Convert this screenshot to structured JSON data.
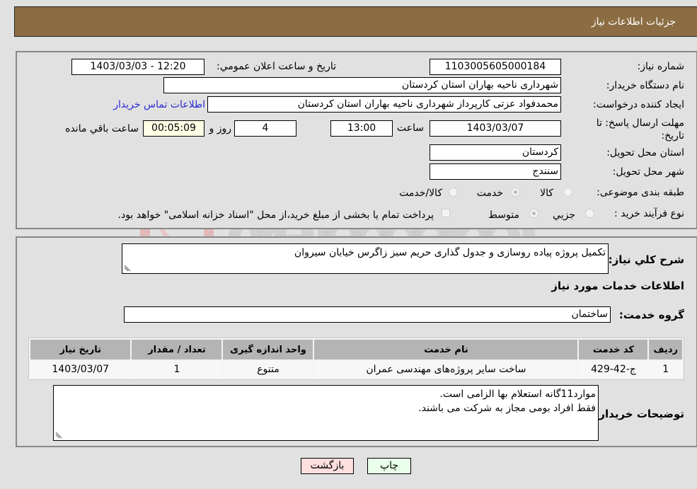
{
  "header": {
    "title": "جزئیات اطلاعات نیاز"
  },
  "form": {
    "need_number": {
      "label": "شماره نیاز:",
      "value": "1103005605000184"
    },
    "announce_datetime": {
      "label": "تاریخ و ساعت اعلان عمومي:",
      "value": "1403/03/03 - 12:20"
    },
    "buyer_org": {
      "label": "نام دستگاه خريدار:",
      "value": "شهرداری ناحیه بهاران استان کردستان"
    },
    "requester": {
      "label": "ایجاد کننده درخواست:",
      "value": "محمدفواد عزتی کارپرداز شهرداری ناحیه بهاران استان کردستان"
    },
    "contact_link": "اطلاعات تماس خریدار",
    "deadline": {
      "label": "مهلت ارسال پاسخ: تا تاریخ:",
      "date": "1403/03/07",
      "time_label": "ساعت",
      "time": "13:00",
      "days": "4",
      "days_label": "روز و",
      "remaining": "00:05:09",
      "remaining_label": "ساعت باقي مانده"
    },
    "province": {
      "label": "استان محل تحویل:",
      "value": "کردستان"
    },
    "city": {
      "label": "شهر محل تحویل:",
      "value": "سنندج"
    },
    "category": {
      "label": "طبقه بندی موضوعی:",
      "options": [
        "کالا",
        "خدمت",
        "کالا/خدمت"
      ],
      "selected": "خدمت"
    },
    "purchase_type": {
      "label": "نوع فرآیند خرید :",
      "options": [
        "جزيي",
        "متوسط"
      ],
      "selected": "متوسط",
      "treasury_note": "پرداخت تمام یا بخشی از مبلغ خرید،از محل \"اسناد خزانه اسلامی\" خواهد بود."
    }
  },
  "details": {
    "description_label": "شرح کلي نياز:",
    "description": "تکمیل پروژه پیاده روسازی و جدول گذاری حریم سبز زاگرس خیابان سیروان",
    "services_title": "اطلاعات خدمات مورد نیاز",
    "service_group_label": "گروه خدمت:",
    "service_group": "ساختمان",
    "table": {
      "headers": [
        "ردیف",
        "کد خدمت",
        "نام خدمت",
        "واحد اندازه گیری",
        "تعداد / مقدار",
        "تاریخ نیاز"
      ],
      "rows": [
        [
          "1",
          "ج-42-429",
          "ساخت سایر پروژه‌های مهندسی عمران",
          "متنوع",
          "1",
          "1403/03/07"
        ]
      ]
    },
    "buyer_notes_label": "توضیحات خریدار:",
    "buyer_notes_line1": "موارد11گانه استعلام بها الزامی است.",
    "buyer_notes_line2": "فقط افراد بومی مجاز به شرکت می باشند."
  },
  "buttons": {
    "print": "چاپ",
    "back": "بازگشت"
  },
  "colors": {
    "header_bg": "#8c6d43",
    "print_bg": "#eaffea",
    "back_bg": "#ffdede",
    "link": "#2b2bd6"
  },
  "watermark": {
    "text": "AriaTender.neT"
  }
}
